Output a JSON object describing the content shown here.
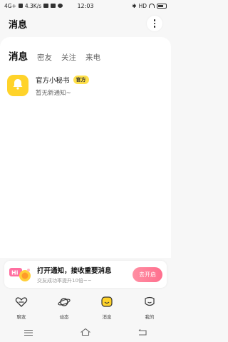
{
  "status": {
    "network": "4G+",
    "speed": "4.3K/s",
    "time": "12:03",
    "hd": "HD",
    "battery_level": 0.6
  },
  "header": {
    "title": "消息"
  },
  "tabs": [
    {
      "label": "消息",
      "active": true
    },
    {
      "label": "密友",
      "active": false
    },
    {
      "label": "关注",
      "active": false
    },
    {
      "label": "来电",
      "active": false
    }
  ],
  "messages": [
    {
      "title": "官方小秘书",
      "badge": "官方",
      "preview": "暂无新通知~",
      "avatar_icon": "bell-icon",
      "avatar_color": "#ffd32a"
    }
  ],
  "notify_banner": {
    "illus_text": "Hi",
    "title": "打开通知，接收重要消息",
    "subtitle": "交友成功率提升10倍~~",
    "button": "去开启"
  },
  "bottom_nav": [
    {
      "label": "聊友",
      "icon": "heart-chat-icon",
      "active": false
    },
    {
      "label": "动态",
      "icon": "planet-icon",
      "active": false
    },
    {
      "label": "消息",
      "icon": "message-face-icon",
      "active": true
    },
    {
      "label": "我的",
      "icon": "profile-face-icon",
      "active": false
    }
  ],
  "colors": {
    "accent": "#ffd32a",
    "button_pink": "#ff7a96"
  }
}
